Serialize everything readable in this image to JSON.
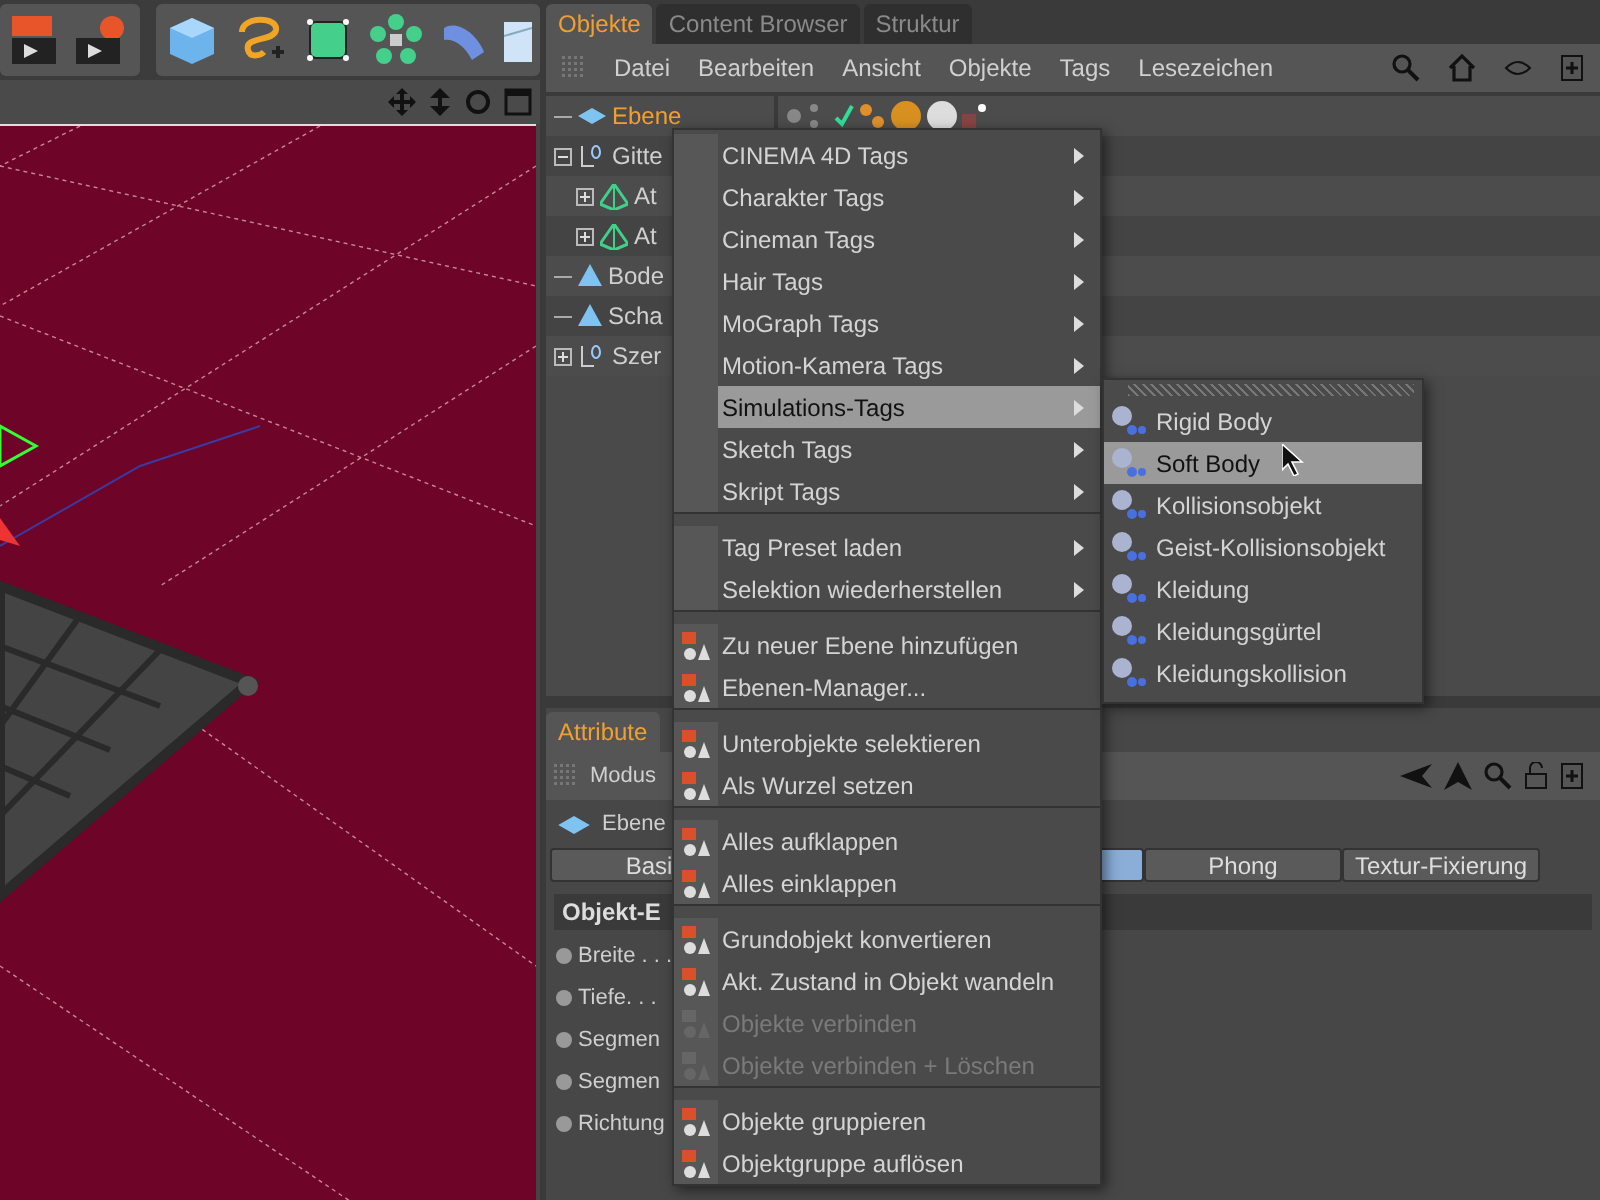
{
  "objects_panel": {
    "tabs": [
      {
        "label": "Objekte",
        "selected": true
      },
      {
        "label": "Content Browser",
        "selected": false
      },
      {
        "label": "Struktur",
        "selected": false
      }
    ],
    "menu": [
      "Datei",
      "Bearbeiten",
      "Ansicht",
      "Objekte",
      "Tags",
      "Lesezeichen"
    ],
    "tree": [
      {
        "name": "Ebene",
        "kind": "plane",
        "selected": true
      },
      {
        "name": "Gitte",
        "kind": "null",
        "selected": false,
        "expanded": true,
        "children": [
          {
            "name": "At",
            "kind": "polygon",
            "selected": false,
            "expanded": false
          },
          {
            "name": "At",
            "kind": "polygon",
            "selected": false,
            "expanded": false
          }
        ]
      },
      {
        "name": "Bode",
        "kind": "cone",
        "selected": false
      },
      {
        "name": "Scha",
        "kind": "cone",
        "selected": false
      },
      {
        "name": "Szer",
        "kind": "null",
        "selected": false,
        "expanded": false
      }
    ]
  },
  "attributes_panel": {
    "tabs": [
      {
        "label": "Attribute",
        "selected": true
      }
    ],
    "menu": [
      "Modus"
    ],
    "object_label": "Ebene",
    "buttons": [
      {
        "label": "Basi",
        "selected": false
      },
      {
        "selected": true
      },
      {
        "label": "Phong",
        "selected": false
      },
      {
        "label": "Textur-Fixierung",
        "selected": false
      }
    ],
    "section": "Objekt-E",
    "params": [
      "Breite . . .",
      "Tiefe. . .",
      "Segmen",
      "Segmen",
      "Richtung"
    ]
  },
  "context_menu": {
    "groups": [
      [
        {
          "label": "CINEMA 4D Tags",
          "kind": "submenu",
          "selected": false
        },
        {
          "label": "Charakter Tags",
          "kind": "submenu",
          "selected": false
        },
        {
          "label": "Cineman Tags",
          "kind": "submenu",
          "selected": false
        },
        {
          "label": "Hair Tags",
          "kind": "submenu",
          "selected": false
        },
        {
          "label": "MoGraph Tags",
          "kind": "submenu",
          "selected": false
        },
        {
          "label": "Motion-Kamera Tags",
          "kind": "submenu",
          "selected": false
        },
        {
          "label": "Simulations-Tags",
          "kind": "submenu",
          "selected": true
        },
        {
          "label": "Sketch Tags",
          "kind": "submenu",
          "selected": false
        },
        {
          "label": "Skript Tags",
          "kind": "submenu",
          "selected": false
        }
      ],
      [
        {
          "label": "Tag Preset laden",
          "kind": "submenu",
          "selected": false
        },
        {
          "label": "Selektion wiederherstellen",
          "kind": "submenu",
          "selected": false
        }
      ],
      [
        {
          "label": "Zu neuer Ebene hinzufügen",
          "kind": "command",
          "selected": false,
          "disabled": false
        },
        {
          "label": "Ebenen-Manager...",
          "kind": "command",
          "selected": false,
          "disabled": false
        }
      ],
      [
        {
          "label": "Unterobjekte selektieren",
          "kind": "command",
          "selected": false,
          "disabled": false
        },
        {
          "label": "Als Wurzel setzen",
          "kind": "command",
          "selected": false,
          "disabled": false
        }
      ],
      [
        {
          "label": "Alles aufklappen",
          "kind": "command",
          "selected": false,
          "disabled": false
        },
        {
          "label": "Alles einklappen",
          "kind": "command",
          "selected": false,
          "disabled": false
        }
      ],
      [
        {
          "label": "Grundobjekt konvertieren",
          "kind": "command",
          "selected": false,
          "disabled": false
        },
        {
          "label": "Akt. Zustand in Objekt wandeln",
          "kind": "command",
          "selected": false,
          "disabled": false
        },
        {
          "label": "Objekte verbinden",
          "kind": "command",
          "selected": false,
          "disabled": true
        },
        {
          "label": "Objekte verbinden + Löschen",
          "kind": "command",
          "selected": false,
          "disabled": true
        }
      ],
      [
        {
          "label": "Objekte gruppieren",
          "kind": "command",
          "selected": false,
          "disabled": false
        },
        {
          "label": "Objektgruppe auflösen",
          "kind": "command",
          "selected": false,
          "disabled": false
        }
      ]
    ]
  },
  "submenu": {
    "items": [
      {
        "label": "Rigid Body",
        "selected": false
      },
      {
        "label": "Soft Body",
        "selected": true
      },
      {
        "label": "Kollisionsobjekt",
        "selected": false
      },
      {
        "label": "Geist-Kollisionsobjekt",
        "selected": false
      },
      {
        "label": "Kleidung",
        "selected": false
      },
      {
        "label": "Kleidungsgürtel",
        "selected": false
      },
      {
        "label": "Kleidungskollision",
        "selected": false
      }
    ]
  }
}
